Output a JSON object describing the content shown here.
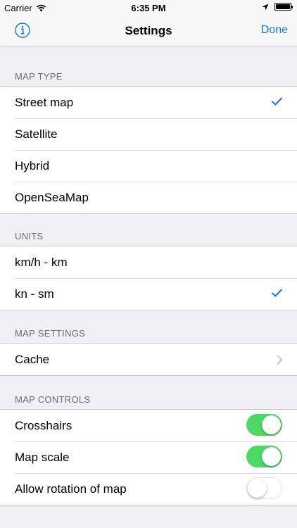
{
  "status_bar": {
    "carrier": "Carrier",
    "time": "6:35 PM"
  },
  "navbar": {
    "title": "Settings",
    "done_label": "Done"
  },
  "accent_color": "#1777e0",
  "toggle_on_color": "#4cd964",
  "sections": {
    "map_type": {
      "header": "MAP TYPE",
      "items": [
        {
          "label": "Street map",
          "selected": true
        },
        {
          "label": "Satellite",
          "selected": false
        },
        {
          "label": "Hybrid",
          "selected": false
        },
        {
          "label": "OpenSeaMap",
          "selected": false
        }
      ]
    },
    "units": {
      "header": "UNITS",
      "items": [
        {
          "label": "km/h - km",
          "selected": false
        },
        {
          "label": "kn - sm",
          "selected": true
        }
      ]
    },
    "map_settings": {
      "header": "MAP SETTINGS",
      "items": [
        {
          "label": "Cache"
        }
      ]
    },
    "map_controls": {
      "header": "MAP CONTROLS",
      "items": [
        {
          "label": "Crosshairs",
          "on": true
        },
        {
          "label": "Map scale",
          "on": true
        },
        {
          "label": "Allow rotation of map",
          "on": false
        }
      ]
    }
  }
}
